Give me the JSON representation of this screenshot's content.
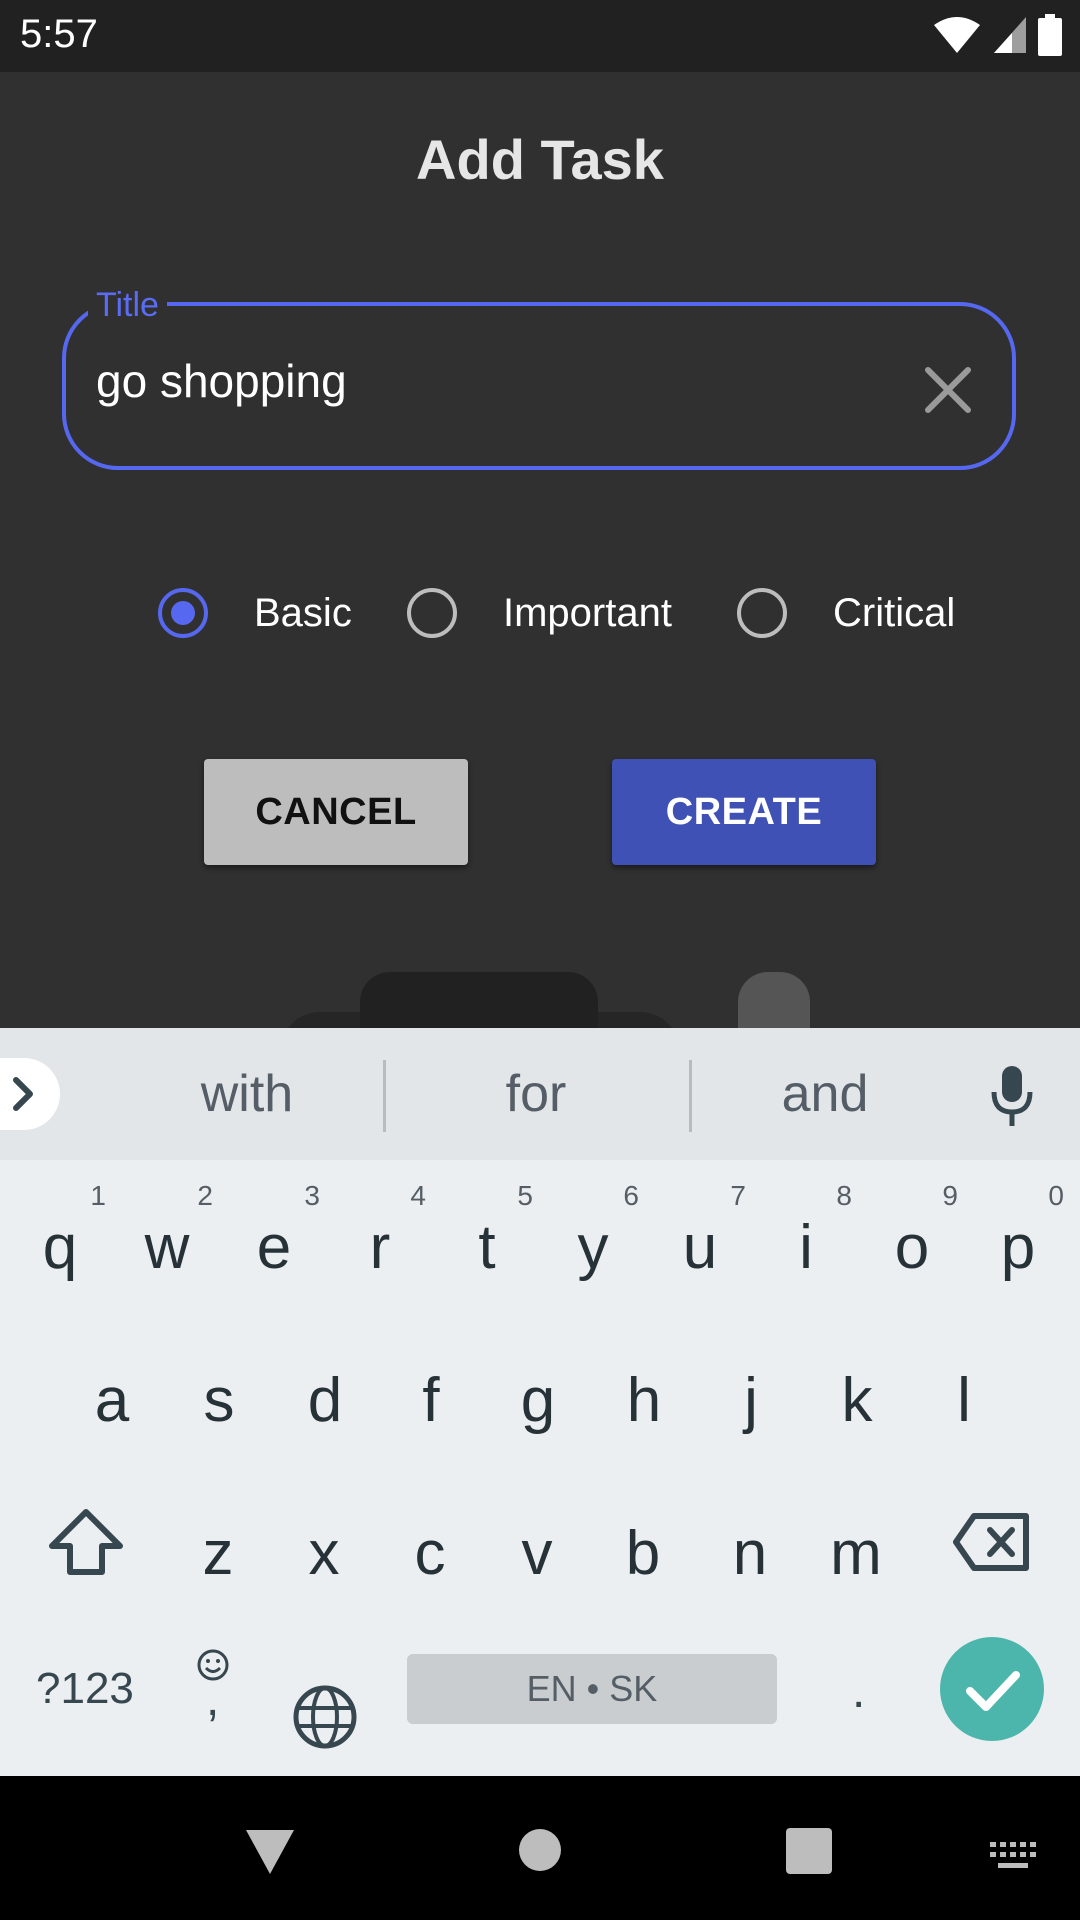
{
  "status_bar": {
    "time": "5:57"
  },
  "dialog": {
    "title": "Add Task",
    "title_field": {
      "label": "Title",
      "value": "go shopping"
    },
    "priority": {
      "options": [
        {
          "label": "Basic",
          "checked": true
        },
        {
          "label": "Important",
          "checked": false
        },
        {
          "label": "Critical",
          "checked": false
        }
      ]
    },
    "cancel_label": "CANCEL",
    "create_label": "CREATE"
  },
  "keyboard": {
    "suggestions": [
      "with",
      "for",
      "and"
    ],
    "row1": [
      {
        "k": "q",
        "h": "1"
      },
      {
        "k": "w",
        "h": "2"
      },
      {
        "k": "e",
        "h": "3"
      },
      {
        "k": "r",
        "h": "4"
      },
      {
        "k": "t",
        "h": "5"
      },
      {
        "k": "y",
        "h": "6"
      },
      {
        "k": "u",
        "h": "7"
      },
      {
        "k": "i",
        "h": "8"
      },
      {
        "k": "o",
        "h": "9"
      },
      {
        "k": "p",
        "h": "0"
      }
    ],
    "row2": [
      "a",
      "s",
      "d",
      "f",
      "g",
      "h",
      "j",
      "k",
      "l"
    ],
    "row3": [
      "z",
      "x",
      "c",
      "v",
      "b",
      "n",
      "m"
    ],
    "symbols_label": "?123",
    "comma_label": ",",
    "space_label": "EN • SK",
    "period_label": "."
  },
  "colors": {
    "accent": "#5668f0",
    "create_button": "#3f51b5",
    "enter_key": "#4db6ac"
  }
}
